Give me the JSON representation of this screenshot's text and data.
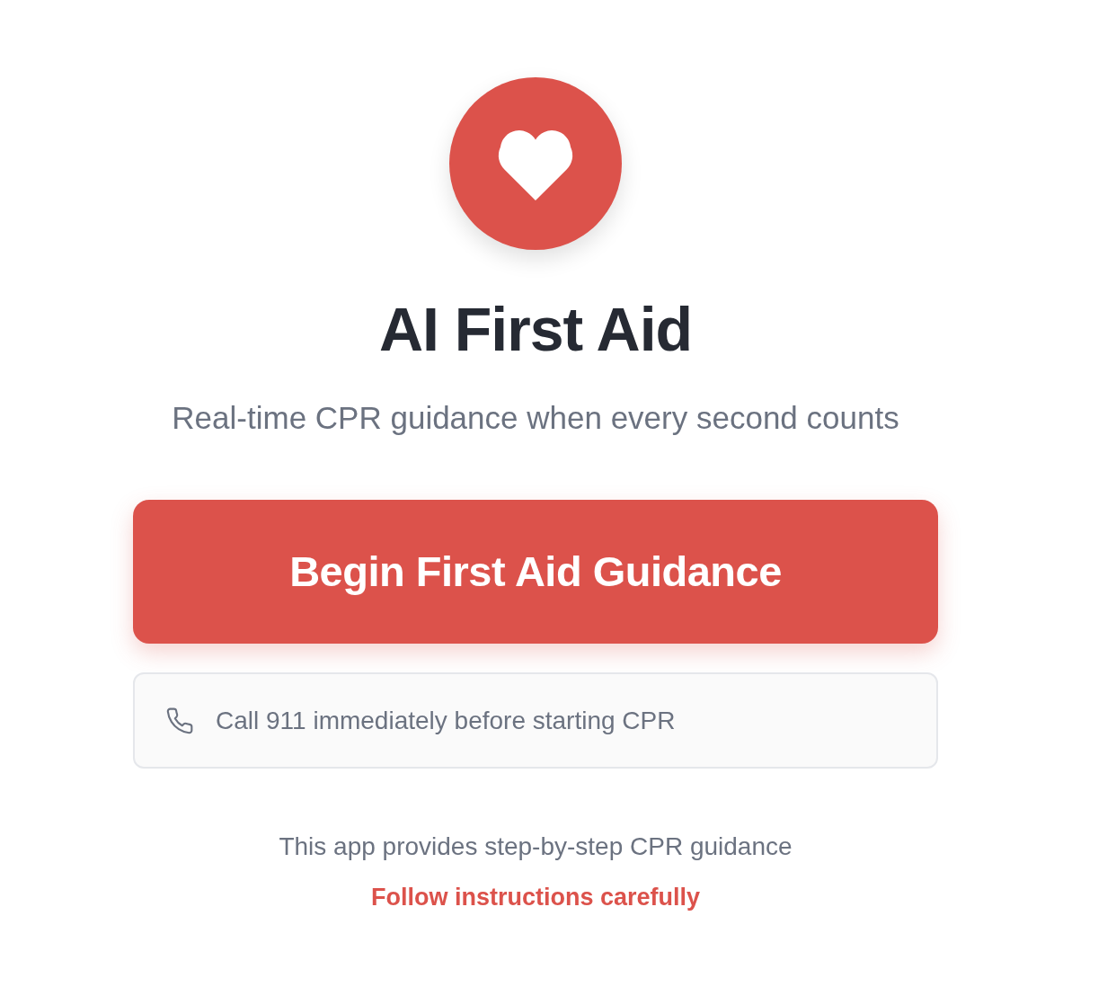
{
  "hero": {
    "title": "AI First Aid",
    "subtitle": "Real-time CPR guidance when every second counts"
  },
  "start_button": {
    "label": "Begin First Aid Guidance"
  },
  "notice": {
    "text": "Call 911 immediately before starting CPR"
  },
  "footer": {
    "note": "This app provides step-by-step CPR guidance",
    "warning": "Follow instructions carefully"
  }
}
